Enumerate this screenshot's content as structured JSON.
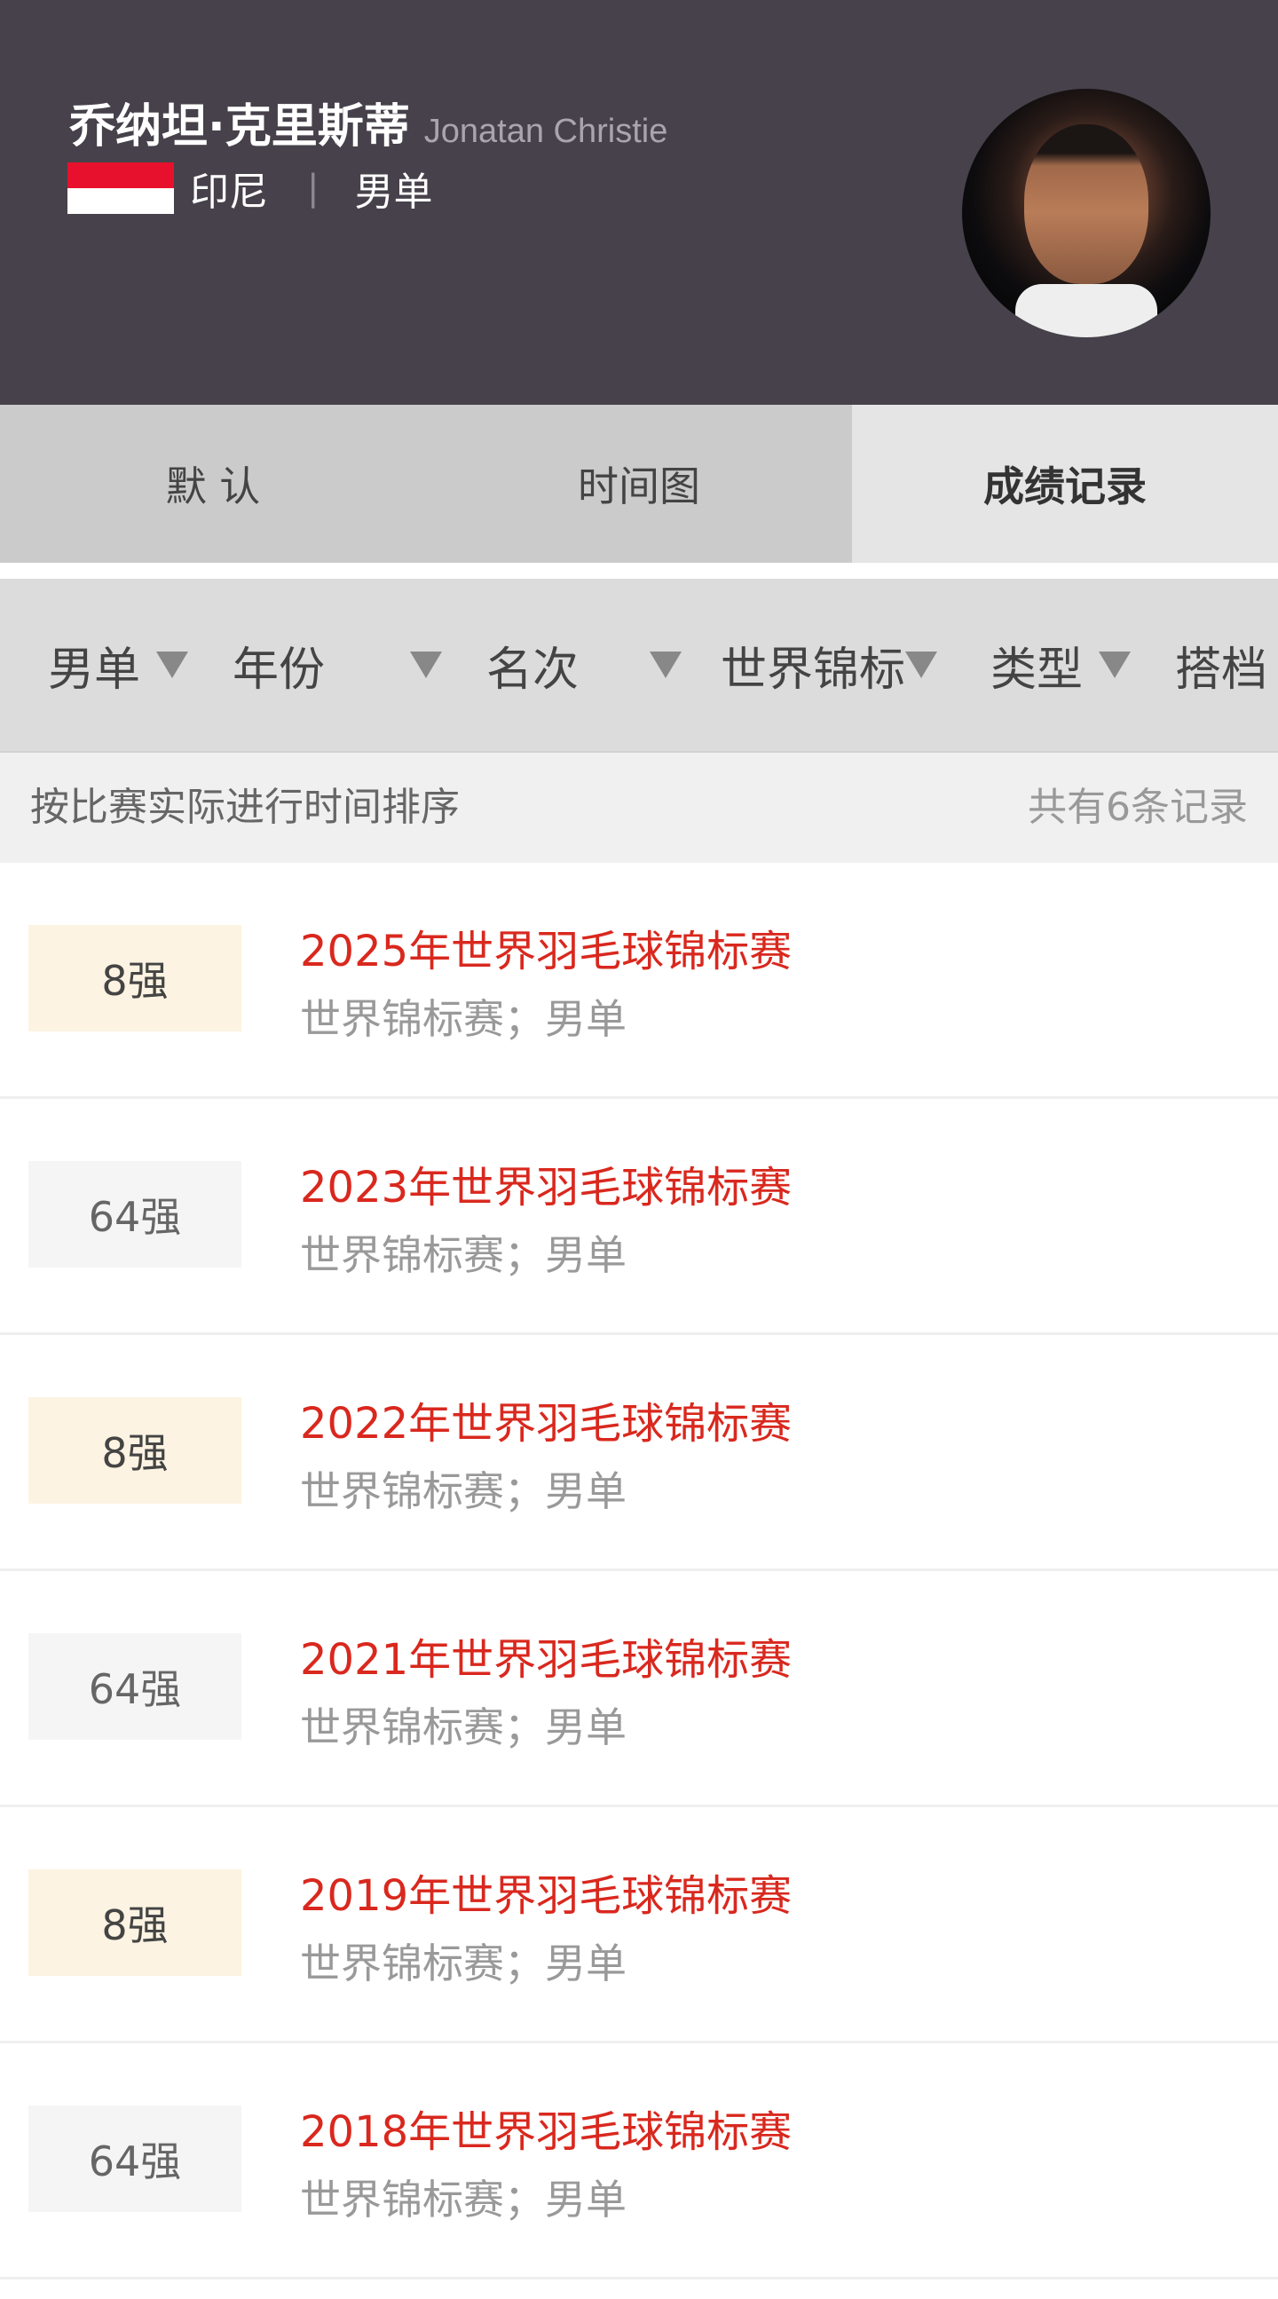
{
  "player": {
    "name_cn": "乔纳坦·克里斯蒂",
    "name_en": "Jonatan Christie",
    "country": "印尼",
    "separator": "|",
    "event": "男单"
  },
  "tabs": [
    {
      "label": "默  认"
    },
    {
      "label": "时间图"
    },
    {
      "label": "成绩记录",
      "active": true
    }
  ],
  "filters": [
    {
      "label": "男单"
    },
    {
      "label": "年份"
    },
    {
      "label": "名次"
    },
    {
      "label": "世界锦标"
    },
    {
      "label": "类型"
    },
    {
      "label": "搭档"
    }
  ],
  "sort": {
    "label": "按比赛实际进行时间排序",
    "count": "共有6条记录"
  },
  "records": [
    {
      "rank": "8强",
      "title": "2025年世界羽毛球锦标赛",
      "sub": "世界锦标赛；男单",
      "highlight": true
    },
    {
      "rank": "64强",
      "title": "2023年世界羽毛球锦标赛",
      "sub": "世界锦标赛；男单",
      "highlight": false
    },
    {
      "rank": "8强",
      "title": "2022年世界羽毛球锦标赛",
      "sub": "世界锦标赛；男单",
      "highlight": true
    },
    {
      "rank": "64强",
      "title": "2021年世界羽毛球锦标赛",
      "sub": "世界锦标赛；男单",
      "highlight": false
    },
    {
      "rank": "8强",
      "title": "2019年世界羽毛球锦标赛",
      "sub": "世界锦标赛；男单",
      "highlight": true
    },
    {
      "rank": "64强",
      "title": "2018年世界羽毛球锦标赛",
      "sub": "世界锦标赛；男单",
      "highlight": false
    }
  ],
  "colors": {
    "header_bg": "#46414a",
    "accent_red": "#d9281e",
    "badge_gold": "#fdf3e2",
    "flag_red": "#e8112d"
  }
}
